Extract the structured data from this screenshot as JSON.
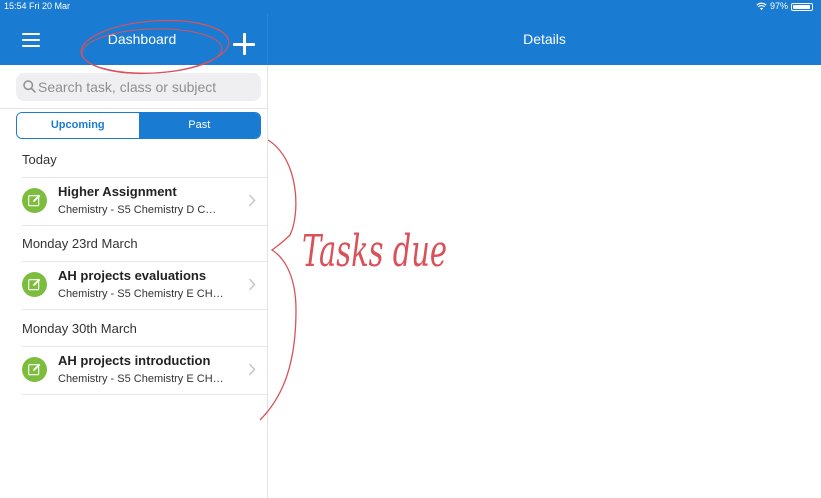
{
  "status": {
    "time": "15:54",
    "date": "Fri 20 Mar",
    "battery": "97%"
  },
  "header": {
    "title": "Dashboard",
    "details_title": "Details"
  },
  "search": {
    "placeholder": "Search task, class or subject"
  },
  "tabs": [
    {
      "label": "Upcoming",
      "active": true
    },
    {
      "label": "Past",
      "active": false
    }
  ],
  "sections": [
    {
      "label": "Today",
      "tasks": [
        {
          "title": "Higher Assignment",
          "subtitle": "Chemistry - S5 Chemistry D C…"
        }
      ]
    },
    {
      "label": "Monday 23rd March",
      "tasks": [
        {
          "title": "AH projects evaluations",
          "subtitle": "Chemistry - S5 Chemistry E CH…"
        }
      ]
    },
    {
      "label": "Monday 30th March",
      "tasks": [
        {
          "title": "AH projects introduction",
          "subtitle": "Chemistry - S5 Chemistry E CH…"
        }
      ]
    }
  ],
  "annotation": {
    "text": "Tasks due",
    "color": "#d9525a"
  },
  "colors": {
    "accent": "#1a7bd3",
    "task_icon": "#7dbd3e"
  },
  "icons": {
    "menu": "hamburger-icon",
    "add": "plus-icon",
    "search": "magnifier-icon",
    "task": "edit-icon",
    "row": "chevron-right-icon"
  }
}
